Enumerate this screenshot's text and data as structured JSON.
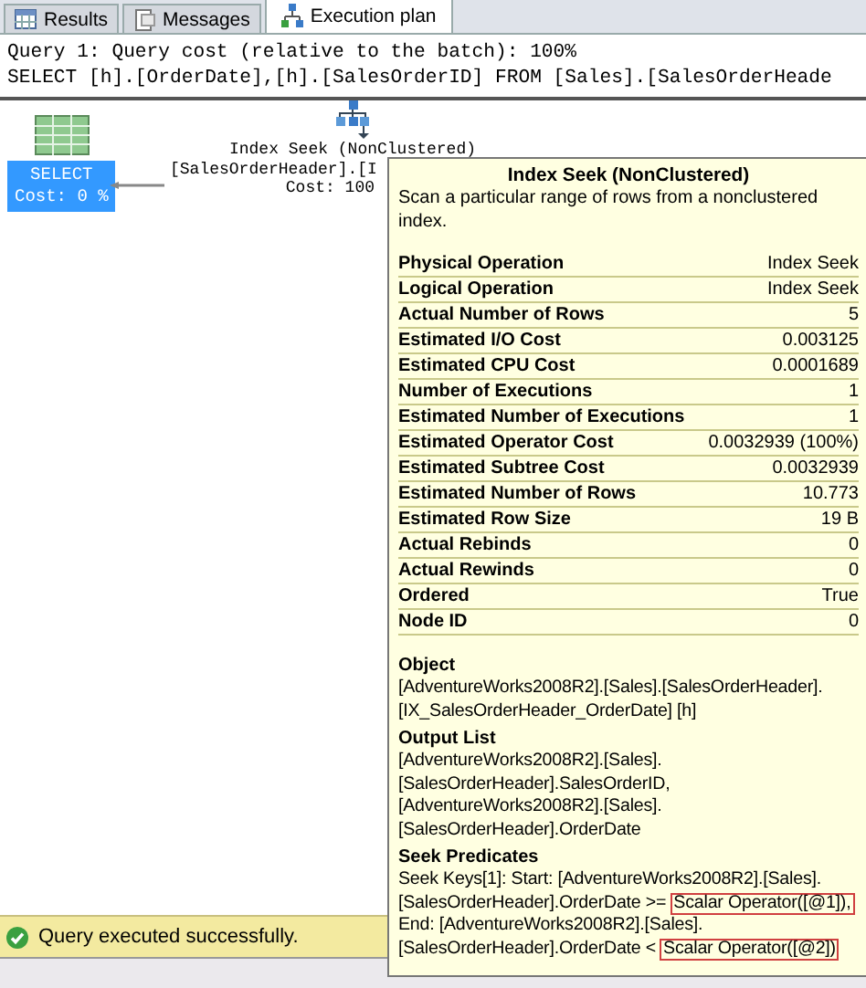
{
  "tabs": [
    {
      "label": "Results",
      "kind": "grid",
      "selected": false
    },
    {
      "label": "Messages",
      "kind": "document",
      "selected": false
    },
    {
      "label": "Execution plan",
      "kind": "plan",
      "selected": true
    }
  ],
  "query_header": [
    "Query 1: Query cost (relative to the batch): 100%",
    "SELECT [h].[OrderDate],[h].[SalesOrderID] FROM [Sales].[SalesOrderHeade"
  ],
  "plan_nodes": [
    {
      "kind": "select",
      "lines": [
        "SELECT",
        "Cost: 0 %"
      ],
      "selected": true
    },
    {
      "kind": "index_seek",
      "lines": [
        "Index Seek (NonClustered)",
        "[SalesOrderHeader].[I",
        "Cost: 100"
      ],
      "selected": false
    }
  ],
  "tooltip": {
    "title": "Index Seek (NonClustered)",
    "description": "Scan a particular range of rows from a nonclustered index.",
    "properties": [
      {
        "name": "Physical Operation",
        "value": "Index Seek"
      },
      {
        "name": "Logical Operation",
        "value": "Index Seek"
      },
      {
        "name": "Actual Number of Rows",
        "value": "5"
      },
      {
        "name": "Estimated I/O Cost",
        "value": "0.003125"
      },
      {
        "name": "Estimated CPU Cost",
        "value": "0.0001689"
      },
      {
        "name": "Number of Executions",
        "value": "1"
      },
      {
        "name": "Estimated Number of Executions",
        "value": "1"
      },
      {
        "name": "Estimated Operator Cost",
        "value": "0.0032939 (100%)"
      },
      {
        "name": "Estimated Subtree Cost",
        "value": "0.0032939"
      },
      {
        "name": "Estimated Number of Rows",
        "value": "10.773"
      },
      {
        "name": "Estimated Row Size",
        "value": "19 B"
      },
      {
        "name": "Actual Rebinds",
        "value": "0"
      },
      {
        "name": "Actual Rewinds",
        "value": "0"
      },
      {
        "name": "Ordered",
        "value": "True"
      },
      {
        "name": "Node ID",
        "value": "0"
      }
    ],
    "sections": [
      {
        "heading": "Object",
        "lines": [
          {
            "parts": [
              {
                "text": "[AdventureWorks2008R2].[Sales].[SalesOrderHeader].",
                "boxed": false
              }
            ]
          },
          {
            "parts": [
              {
                "text": "[IX_SalesOrderHeader_OrderDate] [h]",
                "boxed": false
              }
            ]
          }
        ]
      },
      {
        "heading": "Output List",
        "lines": [
          {
            "parts": [
              {
                "text": "[AdventureWorks2008R2].[Sales].",
                "boxed": false
              }
            ]
          },
          {
            "parts": [
              {
                "text": "[SalesOrderHeader].SalesOrderID,",
                "boxed": false
              }
            ]
          },
          {
            "parts": [
              {
                "text": "[AdventureWorks2008R2].[Sales].",
                "boxed": false
              }
            ]
          },
          {
            "parts": [
              {
                "text": "[SalesOrderHeader].OrderDate",
                "boxed": false
              }
            ]
          }
        ]
      },
      {
        "heading": "Seek Predicates",
        "lines": [
          {
            "parts": [
              {
                "text": "Seek Keys[1]: Start: [AdventureWorks2008R2].[Sales].",
                "boxed": false
              }
            ]
          },
          {
            "parts": [
              {
                "text": "[SalesOrderHeader].OrderDate >=",
                "boxed": false
              },
              {
                "text": "Scalar Operator([@1]),",
                "boxed": true
              }
            ]
          },
          {
            "parts": [
              {
                "text": "End: [AdventureWorks2008R2].[Sales].",
                "boxed": false
              }
            ]
          },
          {
            "parts": [
              {
                "text": "[SalesOrderHeader].OrderDate <",
                "boxed": false
              },
              {
                "text": "Scalar Operator([@2])",
                "boxed": true
              }
            ]
          }
        ]
      }
    ]
  },
  "status_bar": {
    "kind": "success",
    "message": "Query executed successfully."
  }
}
